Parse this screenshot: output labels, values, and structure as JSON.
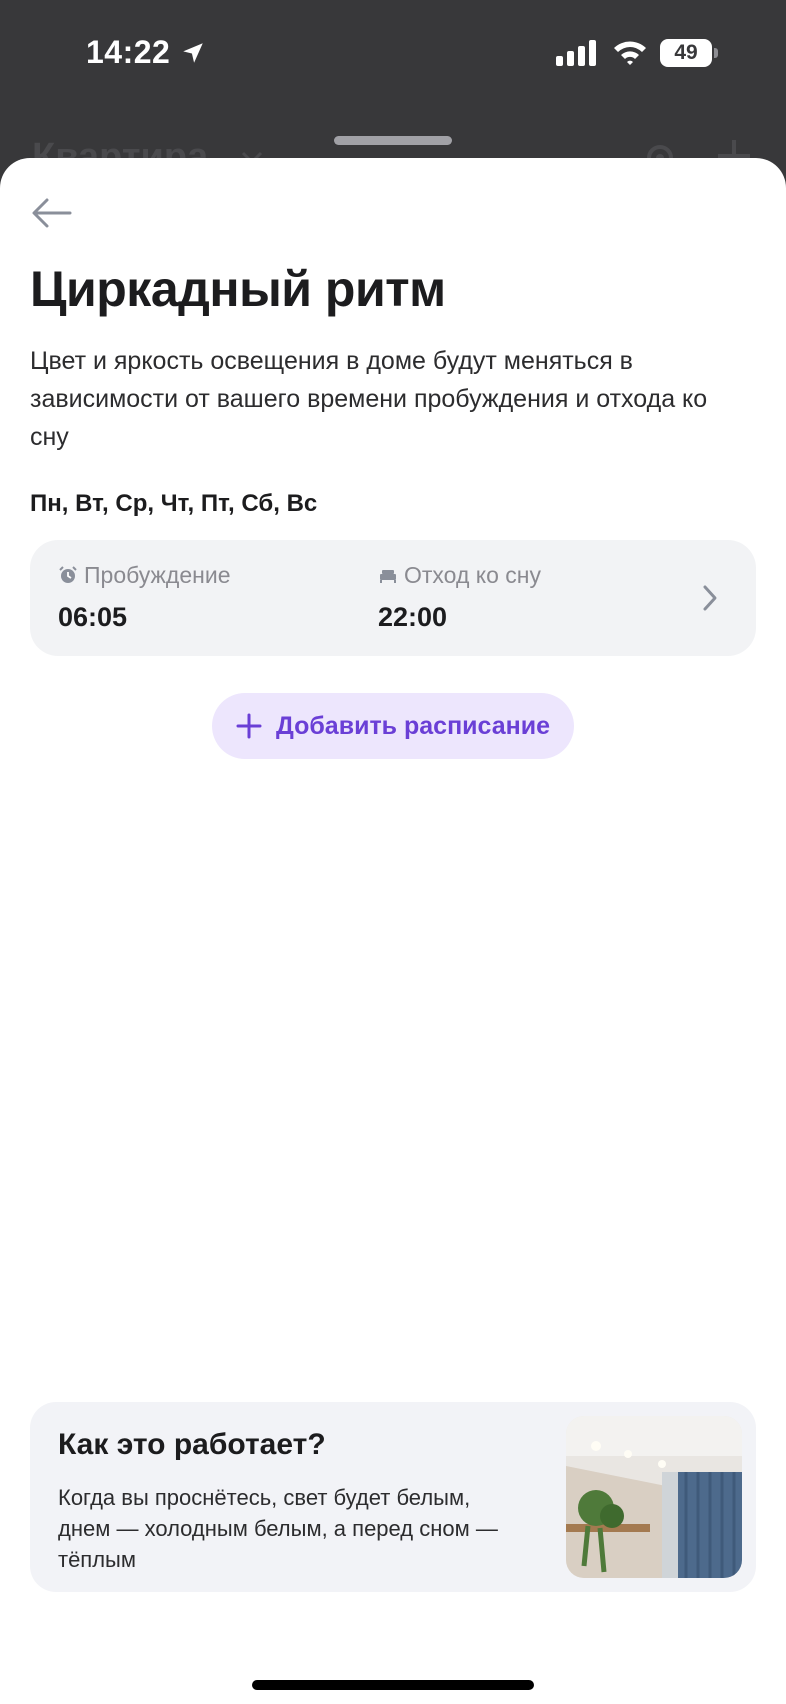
{
  "status_bar": {
    "time": "14:22",
    "battery": "49",
    "icons": [
      "location-arrow-icon",
      "cellular-signal-icon",
      "wifi-icon",
      "battery-icon"
    ]
  },
  "background_app": {
    "title": "Квартира"
  },
  "screen": {
    "title": "Циркадный ритм",
    "description": "Цвет и яркость освещения в доме будут меняться в зависимости от вашего времени пробуждения и отхода ко сну",
    "days": "Пн, Вт, Ср, Чт, Пт, Сб, Вс",
    "schedule": {
      "wake_label": "Пробуждение",
      "wake_time": "06:05",
      "sleep_label": "Отход ко сну",
      "sleep_time": "22:00"
    },
    "add_schedule_label": "Добавить расписание"
  },
  "info_card": {
    "title": "Как это работает?",
    "text": "Когда вы проснётесь, свет будет белым, днем — холодным белым, а перед сном — тёплым"
  },
  "colors": {
    "accent": "#6a3fd6",
    "accent_bg": "#ede6fd",
    "card_bg": "#f2f3f5",
    "muted_text": "#8a8a90"
  }
}
